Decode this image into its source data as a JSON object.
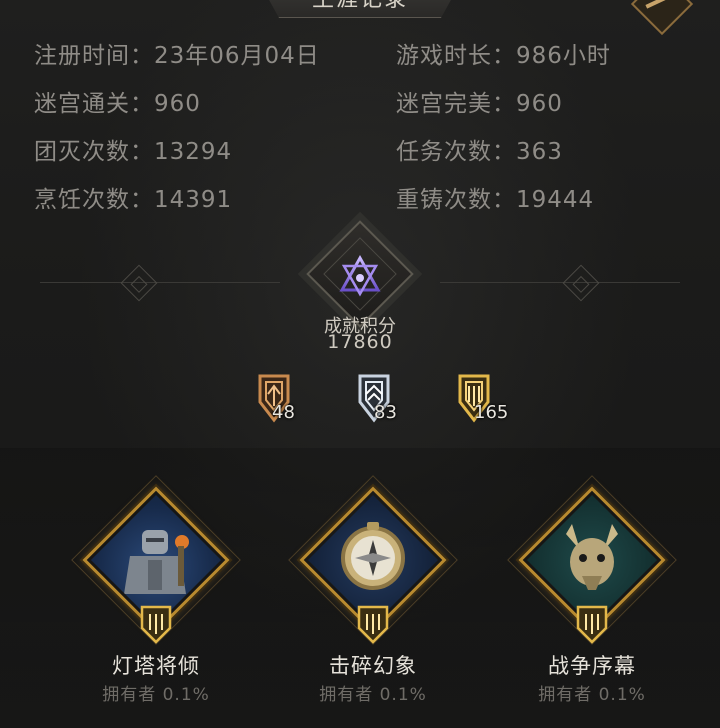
{
  "header": {
    "title": "生涯记录"
  },
  "stats": [
    {
      "label": "注册时间：",
      "value": "23年06月04日"
    },
    {
      "label": "游戏时长：",
      "value": "986小时"
    },
    {
      "label": "迷宫通关：",
      "value": "960"
    },
    {
      "label": "迷宫完美：",
      "value": "960"
    },
    {
      "label": "团灭次数：",
      "value": "13294"
    },
    {
      "label": "任务次数：",
      "value": "363"
    },
    {
      "label": "烹饪次数：",
      "value": "14391"
    },
    {
      "label": "重铸次数：",
      "value": "19444"
    }
  ],
  "achievement": {
    "label": "成就积分",
    "score": "17860",
    "icon": "triangle-emblem-icon",
    "medals": [
      {
        "tier": "bronze",
        "count": "48",
        "color": "#c98a4e"
      },
      {
        "tier": "silver",
        "count": "83",
        "color": "#c9d3e0"
      },
      {
        "tier": "gold",
        "count": "165",
        "color": "#e3b84a"
      }
    ]
  },
  "badges": [
    {
      "name": "灯塔将倾",
      "owner": "拥有者 0.1%",
      "icon": "armored-knight-icon"
    },
    {
      "name": "击碎幻象",
      "owner": "拥有者 0.1%",
      "icon": "compass-icon"
    },
    {
      "name": "战争序幕",
      "owner": "拥有者 0.1%",
      "icon": "dragon-skull-icon"
    }
  ],
  "colors": {
    "background": "#1c1c1b",
    "text_muted": "#8f8c87",
    "text_light": "#e6e2da",
    "gold_frame": "#b88a2f",
    "emblem_purple": "#8a6de0"
  }
}
